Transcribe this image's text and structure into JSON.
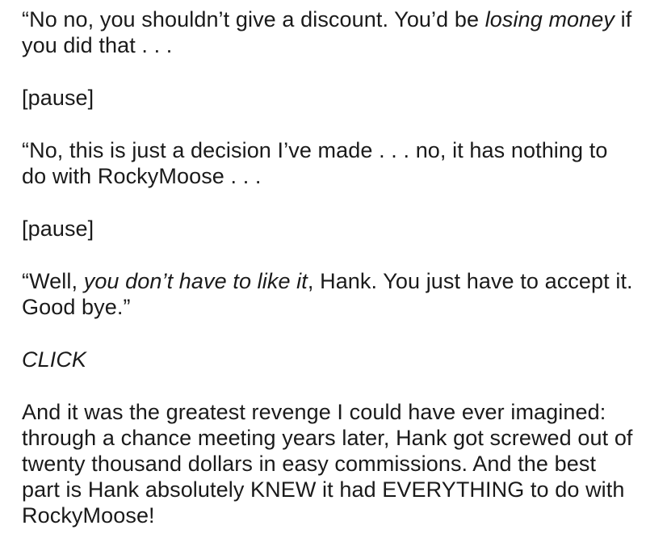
{
  "paragraphs": [
    {
      "id": "p1",
      "segments": [
        {
          "text": "“No no, you shouldn’t give a discount. You’d be ",
          "italic": false
        },
        {
          "text": "losing money",
          "italic": true
        },
        {
          "text": " if you did that . . .",
          "italic": false
        }
      ]
    },
    {
      "id": "p2",
      "segments": [
        {
          "text": "[pause]",
          "italic": false
        }
      ]
    },
    {
      "id": "p3",
      "segments": [
        {
          "text": "“No, this is just a decision I’ve made . . . no, it has nothing to do with RockyMoose . . .",
          "italic": false
        }
      ]
    },
    {
      "id": "p4",
      "segments": [
        {
          "text": "[pause]",
          "italic": false
        }
      ]
    },
    {
      "id": "p5",
      "segments": [
        {
          "text": "“Well, ",
          "italic": false
        },
        {
          "text": "you don’t have to like it",
          "italic": true
        },
        {
          "text": ", Hank. You just have to accept it. Good bye.”",
          "italic": false
        }
      ]
    },
    {
      "id": "p6",
      "segments": [
        {
          "text": "CLICK",
          "italic": true
        }
      ]
    },
    {
      "id": "p7",
      "segments": [
        {
          "text": "And it was the greatest revenge I could have ever imagined: through a chance meeting years later, Hank got screwed out of twenty thousand dollars in easy commissions. And the best part is Hank absolutely KNEW it had EVERYTHING to do with RockyMoose!",
          "italic": false
        }
      ]
    }
  ]
}
